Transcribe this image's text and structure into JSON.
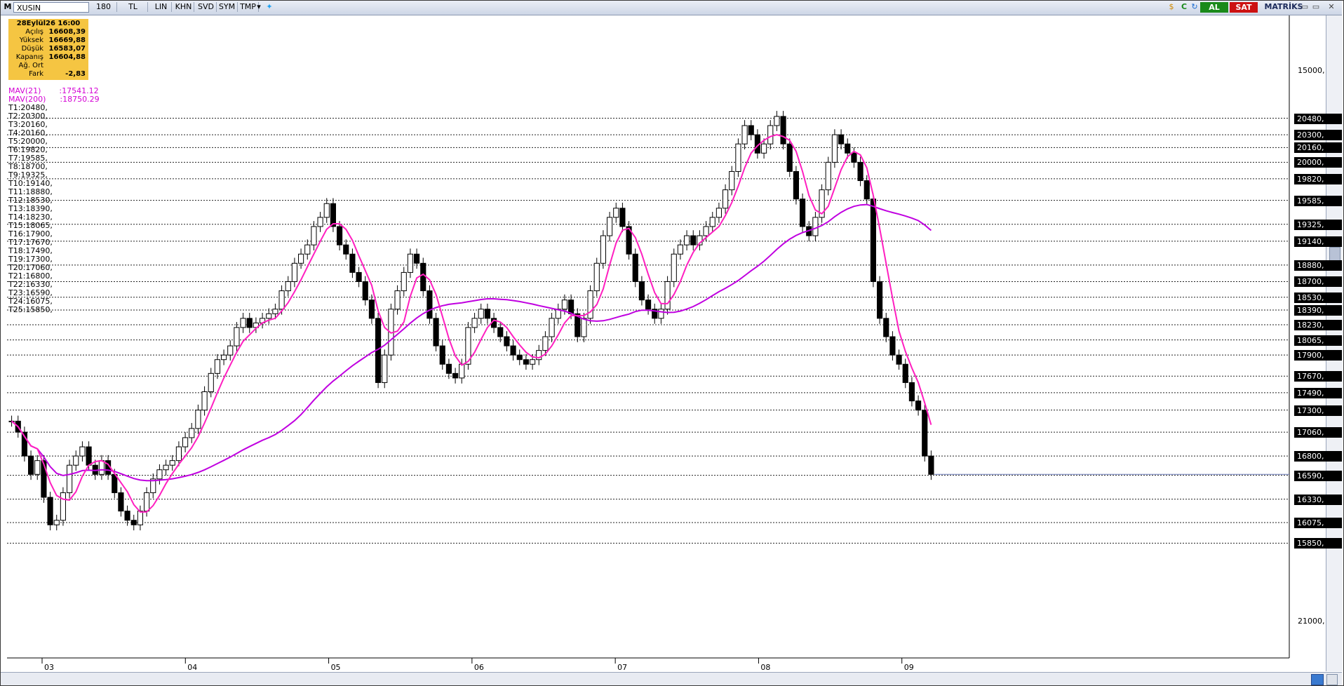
{
  "toolbar": {
    "symbol_prefix": "M",
    "symbol": "XUSIN",
    "period": "180",
    "currency": "TL",
    "buttons": [
      "LIN",
      "KHN",
      "SVD",
      "SYM",
      "TMP"
    ],
    "brand": "MATRİKS",
    "buy_label": "AL",
    "sell_label": "SAT",
    "c_label": "C"
  },
  "infobox": {
    "title": "28Eylül26 16:00",
    "rows": [
      {
        "label": "Açılış",
        "value": "16608,39"
      },
      {
        "label": "Yüksek",
        "value": "16669,88"
      },
      {
        "label": "Düşük",
        "value": "16583,07"
      },
      {
        "label": "Kapanış",
        "value": "16604,88"
      },
      {
        "label": "Ağ. Ort",
        "value": ""
      },
      {
        "label": "Fark",
        "value": "-2,83"
      }
    ]
  },
  "indicators": [
    {
      "label": "MAV(21)",
      "value": ":17541.12"
    },
    {
      "label": "MAV(200)",
      "value": ":18750.29"
    }
  ],
  "colors": {
    "mav21": "#ff1fc0",
    "mav200": "#c000e0",
    "candle": "#000000",
    "infobox_bg": "#f5c542",
    "buy": "#1a8a1a",
    "sell": "#cc1111"
  },
  "chart_data": {
    "type": "line",
    "title": "XUSIN",
    "y_ticks": [
      15000,
      21000
    ],
    "ylim": [
      14600,
      21600
    ],
    "x_labels": [
      "03",
      "04",
      "05",
      "06",
      "07",
      "08",
      "09"
    ],
    "levels": [
      {
        "name": "T1",
        "value": 20480
      },
      {
        "name": "T2",
        "value": 20300
      },
      {
        "name": "T3",
        "value": 20160
      },
      {
        "name": "T4",
        "value": 20160
      },
      {
        "name": "T5",
        "value": 20000
      },
      {
        "name": "T6",
        "value": 19820
      },
      {
        "name": "T7",
        "value": 19585
      },
      {
        "name": "T8",
        "value": 18700
      },
      {
        "name": "T9",
        "value": 19325
      },
      {
        "name": "T10",
        "value": 19140
      },
      {
        "name": "T11",
        "value": 18880
      },
      {
        "name": "T12",
        "value": 18530
      },
      {
        "name": "T13",
        "value": 18390
      },
      {
        "name": "T14",
        "value": 18230
      },
      {
        "name": "T15",
        "value": 18065
      },
      {
        "name": "T16",
        "value": 17900
      },
      {
        "name": "T17",
        "value": 17670
      },
      {
        "name": "T18",
        "value": 17490
      },
      {
        "name": "T19",
        "value": 17300
      },
      {
        "name": "T20",
        "value": 17060
      },
      {
        "name": "T21",
        "value": 16800
      },
      {
        "name": "T22",
        "value": 16330
      },
      {
        "name": "T23",
        "value": 16590
      },
      {
        "name": "T24",
        "value": 16075
      },
      {
        "name": "T25",
        "value": 15850
      }
    ],
    "tag_labels": [
      "20480,",
      "20300,",
      "20160,",
      "20000,",
      "19820,",
      "19585,",
      "19325,",
      "19140,",
      "18880,",
      "18700,",
      "18530,",
      "18390,",
      "18230,",
      "18065,",
      "17900,",
      "17670,",
      "17490,",
      "17300,",
      "17060,",
      "16800,",
      "16590,",
      "16330,",
      "16075,",
      "15850,"
    ],
    "tag_values": [
      20480,
      20300,
      20160,
      20000,
      19820,
      19585,
      19325,
      19140,
      18880,
      18700,
      18530,
      18390,
      18230,
      18065,
      17900,
      17670,
      17490,
      17300,
      17060,
      16800,
      16590,
      16330,
      16075,
      15850
    ],
    "y_tick_labels": [
      "21000,",
      "15000,"
    ],
    "close_series": [
      17180,
      17060,
      16800,
      16600,
      16750,
      16350,
      16050,
      16100,
      16400,
      16700,
      16800,
      16900,
      16700,
      16600,
      16750,
      16600,
      16400,
      16200,
      16100,
      16050,
      16200,
      16400,
      16550,
      16650,
      16700,
      16750,
      16900,
      17000,
      17100,
      17300,
      17500,
      17700,
      17850,
      17900,
      18000,
      18200,
      18300,
      18200,
      18250,
      18300,
      18350,
      18400,
      18600,
      18700,
      18900,
      19000,
      19100,
      19300,
      19400,
      19550,
      19300,
      19100,
      19000,
      18800,
      18700,
      18500,
      18300,
      17600,
      17900,
      18400,
      18600,
      18800,
      19000,
      18900,
      18600,
      18300,
      18000,
      17800,
      17700,
      17650,
      17800,
      18200,
      18300,
      18400,
      18300,
      18200,
      18100,
      18000,
      17900,
      17850,
      17800,
      17850,
      17950,
      18100,
      18300,
      18400,
      18500,
      18350,
      18100,
      18300,
      18600,
      18900,
      19200,
      19400,
      19500,
      19300,
      19000,
      18700,
      18500,
      18400,
      18300,
      18400,
      18700,
      19000,
      19100,
      19200,
      19100,
      19200,
      19300,
      19400,
      19500,
      19700,
      19900,
      20200,
      20400,
      20300,
      20100,
      20200,
      20400,
      20500,
      20200,
      19900,
      19600,
      19300,
      19200,
      19400,
      19700,
      20000,
      20300,
      20200,
      20100,
      20000,
      19800,
      19600,
      18700,
      18300,
      18100,
      17900,
      17800,
      17600,
      17400,
      17300,
      16800,
      16600
    ]
  }
}
